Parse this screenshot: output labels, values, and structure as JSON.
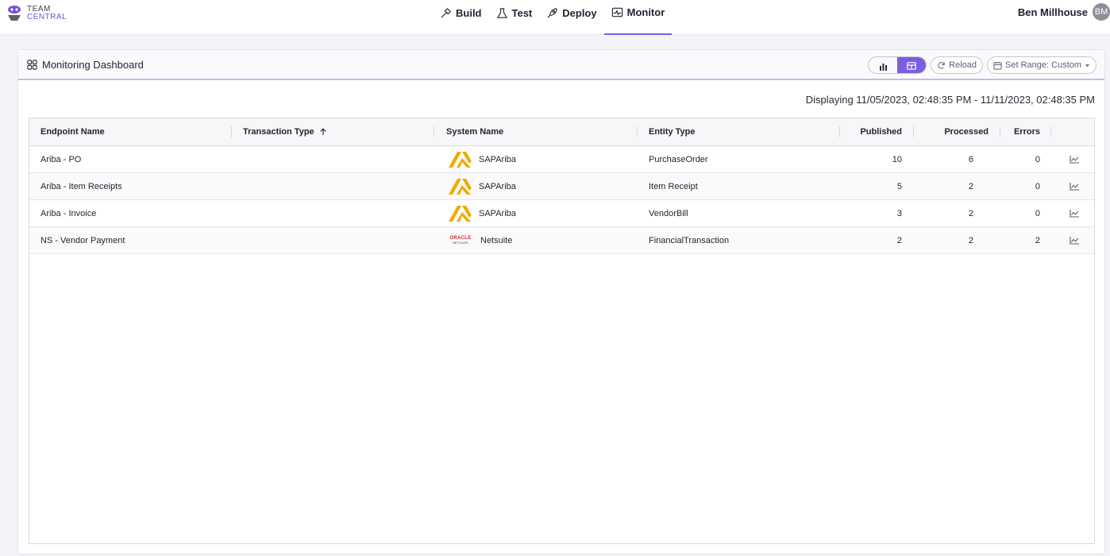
{
  "app": {
    "logo_line1": "TEAM",
    "logo_line2": "CENTRAL"
  },
  "nav": {
    "items": [
      {
        "label": "Build",
        "icon": "hammer-icon"
      },
      {
        "label": "Test",
        "icon": "flask-icon"
      },
      {
        "label": "Deploy",
        "icon": "rocket-icon"
      },
      {
        "label": "Monitor",
        "icon": "monitor-icon",
        "active": true
      }
    ]
  },
  "user": {
    "name": "Ben Millhouse",
    "initials": "BM"
  },
  "panel": {
    "title": "Monitoring Dashboard",
    "reload_label": "Reload",
    "range_label": "Set Range: Custom",
    "view_mode": "table",
    "range_text": "Displaying 11/05/2023, 02:48:35 PM - 11/11/2023, 02:48:35 PM"
  },
  "table": {
    "columns": {
      "endpoint": "Endpoint Name",
      "transaction": "Transaction Type",
      "system": "System Name",
      "entity": "Entity Type",
      "published": "Published",
      "processed": "Processed",
      "errors": "Errors"
    },
    "sort": {
      "column": "transaction",
      "direction": "asc"
    },
    "rows": [
      {
        "endpoint": "Ariba - PO",
        "transaction": "",
        "system": "SAPAriba",
        "entity": "PurchaseOrder",
        "published": "10",
        "processed": "6",
        "errors": "0"
      },
      {
        "endpoint": "Ariba - Item Receipts",
        "transaction": "",
        "system": "SAPAriba",
        "entity": "Item Receipt",
        "published": "5",
        "processed": "2",
        "errors": "0"
      },
      {
        "endpoint": "Ariba - Invoice",
        "transaction": "",
        "system": "SAPAriba",
        "entity": "VendorBill",
        "published": "3",
        "processed": "2",
        "errors": "0"
      },
      {
        "endpoint": "NS - Vendor Payment",
        "transaction": "",
        "system": "Netsuite",
        "entity": "FinancialTransaction",
        "published": "2",
        "processed": "2",
        "errors": "2"
      }
    ],
    "logos": {
      "oracle_line1": "ORACLE",
      "oracle_line2": "NETSUITE"
    }
  },
  "colors": {
    "accent": "#7b5ee0",
    "ariba_yellow": "#f0ab00"
  }
}
